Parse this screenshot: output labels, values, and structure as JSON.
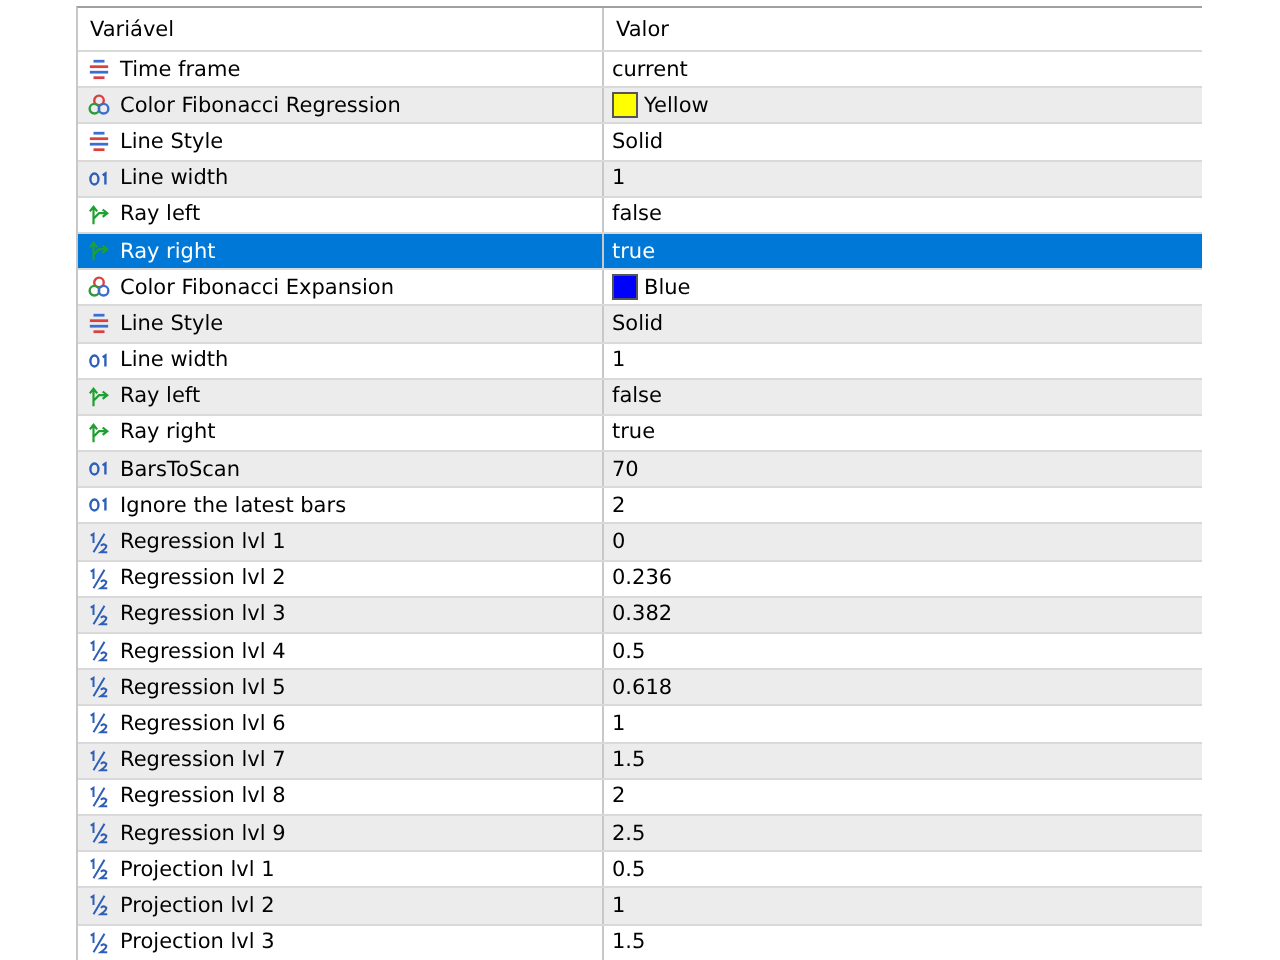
{
  "table": {
    "columns": [
      "Variável",
      "Valor"
    ],
    "rows": [
      {
        "kind": "enum",
        "name": "Time frame",
        "value": "current",
        "selected": false
      },
      {
        "kind": "color",
        "name": "Color Fibonacci Regression",
        "value": "Yellow",
        "color": "#ffff00",
        "selected": false
      },
      {
        "kind": "enum",
        "name": "Line Style",
        "value": "Solid",
        "selected": false
      },
      {
        "kind": "int",
        "name": "Line width",
        "value": "1",
        "selected": false
      },
      {
        "kind": "bool",
        "name": "Ray left",
        "value": "false",
        "selected": false
      },
      {
        "kind": "bool",
        "name": "Ray right",
        "value": "true",
        "selected": true
      },
      {
        "kind": "color",
        "name": "Color Fibonacci Expansion",
        "value": "Blue",
        "color": "#0000ff",
        "selected": false
      },
      {
        "kind": "enum",
        "name": "Line Style",
        "value": "Solid",
        "selected": false
      },
      {
        "kind": "int",
        "name": "Line width",
        "value": "1",
        "selected": false
      },
      {
        "kind": "bool",
        "name": "Ray left",
        "value": "false",
        "selected": false
      },
      {
        "kind": "bool",
        "name": "Ray right",
        "value": "true",
        "selected": false
      },
      {
        "kind": "int",
        "name": "BarsToScan",
        "value": "70",
        "selected": false
      },
      {
        "kind": "int",
        "name": "Ignore the latest bars",
        "value": "2",
        "selected": false
      },
      {
        "kind": "double",
        "name": "Regression lvl 1",
        "value": "0",
        "selected": false
      },
      {
        "kind": "double",
        "name": "Regression lvl 2",
        "value": "0.236",
        "selected": false
      },
      {
        "kind": "double",
        "name": "Regression lvl 3",
        "value": "0.382",
        "selected": false
      },
      {
        "kind": "double",
        "name": "Regression lvl 4",
        "value": "0.5",
        "selected": false
      },
      {
        "kind": "double",
        "name": "Regression lvl 5",
        "value": "0.618",
        "selected": false
      },
      {
        "kind": "double",
        "name": "Regression lvl 6",
        "value": "1",
        "selected": false
      },
      {
        "kind": "double",
        "name": "Regression lvl 7",
        "value": "1.5",
        "selected": false
      },
      {
        "kind": "double",
        "name": "Regression lvl 8",
        "value": "2",
        "selected": false
      },
      {
        "kind": "double",
        "name": "Regression lvl 9",
        "value": "2.5",
        "selected": false
      },
      {
        "kind": "double",
        "name": "Projection lvl 1",
        "value": "0.5",
        "selected": false
      },
      {
        "kind": "double",
        "name": "Projection lvl 2",
        "value": "1",
        "selected": false
      },
      {
        "kind": "double",
        "name": "Projection lvl 3",
        "value": "1.5",
        "selected": false
      }
    ]
  }
}
